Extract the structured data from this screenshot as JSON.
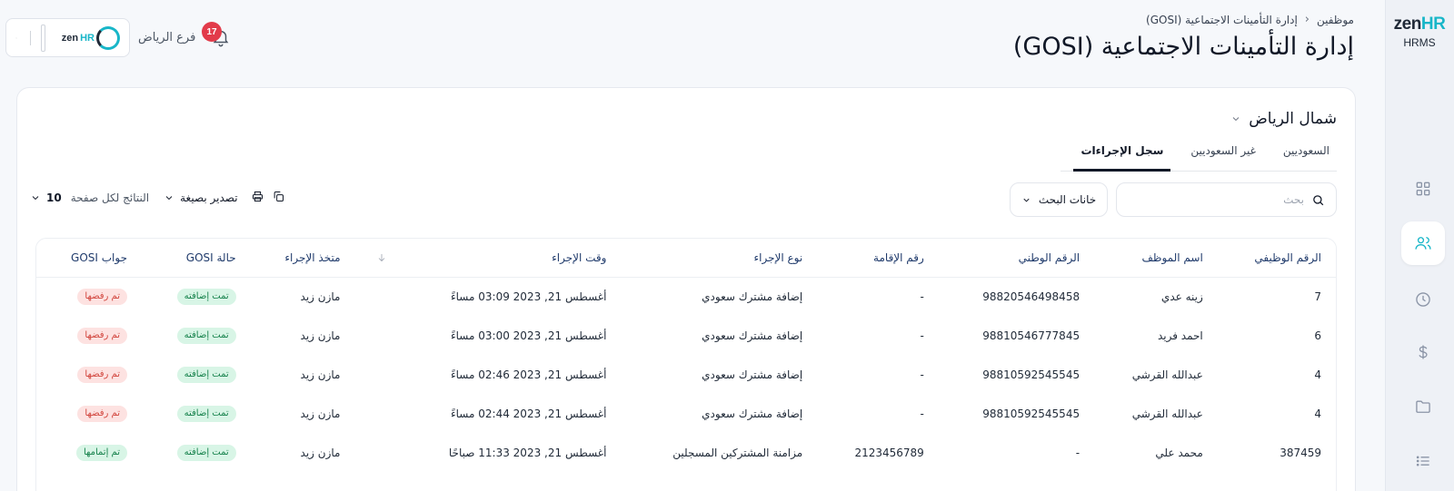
{
  "brand": {
    "logo_main": "zen",
    "logo_accent": "HR",
    "sub": "HRMS"
  },
  "sidebar": {
    "items": [
      {
        "icon": "grid-icon"
      },
      {
        "icon": "users-icon",
        "active": true
      },
      {
        "icon": "clock-icon"
      },
      {
        "icon": "dollar-icon"
      },
      {
        "icon": "folder-icon"
      },
      {
        "icon": "list-icon"
      }
    ]
  },
  "header": {
    "breadcrumb": [
      "موظفين",
      "إدارة التأمينات الاجتماعية (GOSI)"
    ],
    "title": "إدارة التأمينات الاجتماعية (GOSI)",
    "notifications_count": "17",
    "branch": "فرع الرياض",
    "company_logo_main": "zen",
    "company_logo_accent": "HR"
  },
  "card": {
    "title": "شمال الرياض",
    "tabs": [
      {
        "label": "السعوديين",
        "active": false
      },
      {
        "label": "غير السعوديين",
        "active": false
      },
      {
        "label": "سجل الإجراءات",
        "active": true
      }
    ],
    "search_placeholder": "بحث",
    "search_columns_label": "خانات البحث",
    "export_label": "تصدير بصيغة",
    "per_page_label": "النتائج لكل صفحة",
    "per_page_value": "10"
  },
  "table": {
    "columns": [
      "الرقم الوظيفي",
      "اسم الموظف",
      "الرقم الوطني",
      "رقم الإقامة",
      "نوع الإجراء",
      "وقت الإجراء",
      "",
      "متخذ الإجراء",
      "حالة GOSI",
      "جواب GOSI"
    ],
    "rows": [
      {
        "emp_id": "7",
        "name": "زينه عدي",
        "national_id": "98820546498458",
        "iqama": "-",
        "action_type": "إضافة مشترك سعودي",
        "action_time": "أغسطس 21, 2023 03:09 مساءً",
        "by": "مازن زيد",
        "status": "تمت إضافته",
        "response": "تم رفضها",
        "response_color": "red"
      },
      {
        "emp_id": "6",
        "name": "احمد فريد",
        "national_id": "98810546777845",
        "iqama": "-",
        "action_type": "إضافة مشترك سعودي",
        "action_time": "أغسطس 21, 2023 03:00 مساءً",
        "by": "مازن زيد",
        "status": "تمت إضافته",
        "response": "تم رفضها",
        "response_color": "red"
      },
      {
        "emp_id": "4",
        "name": "عبدالله القرشي",
        "national_id": "98810592545545",
        "iqama": "-",
        "action_type": "إضافة مشترك سعودي",
        "action_time": "أغسطس 21, 2023 02:46 مساءً",
        "by": "مازن زيد",
        "status": "تمت إضافته",
        "response": "تم رفضها",
        "response_color": "red"
      },
      {
        "emp_id": "4",
        "name": "عبدالله القرشي",
        "national_id": "98810592545545",
        "iqama": "-",
        "action_type": "إضافة مشترك سعودي",
        "action_time": "أغسطس 21, 2023 02:44 مساءً",
        "by": "مازن زيد",
        "status": "تمت إضافته",
        "response": "تم رفضها",
        "response_color": "red"
      },
      {
        "emp_id": "387459",
        "name": "محمد علي",
        "national_id": "-",
        "iqama": "2123456789",
        "action_type": "مزامنة المشتركين المسجلين",
        "action_time": "أغسطس 21, 2023 11:33 صباحًا",
        "by": "مازن زيد",
        "status": "تمت إضافته",
        "response": "تم إتمامها",
        "response_color": "green"
      }
    ]
  },
  "colors": {
    "accent": "#18b6c8",
    "badge": "#e23b4a",
    "success_bg": "#d8f5e6",
    "danger_bg": "#fde2e1"
  }
}
